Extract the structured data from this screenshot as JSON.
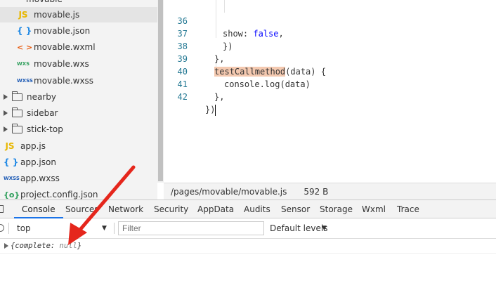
{
  "file_tree": {
    "partial_top_label": "movable",
    "items": [
      {
        "label": "movable.js",
        "icon_text": "JS",
        "kind": "js",
        "selected": true
      },
      {
        "label": "movable.json",
        "icon_text": "{ }",
        "kind": "json"
      },
      {
        "label": "movable.wxml",
        "icon_text": "< >",
        "kind": "wxml"
      },
      {
        "label": "movable.wxs",
        "icon_text": "WXS",
        "kind": "wxs"
      },
      {
        "label": "movable.wxss",
        "icon_text": "WXSS",
        "kind": "wxss"
      },
      {
        "label": "nearby",
        "kind": "folder"
      },
      {
        "label": "sidebar",
        "kind": "folder"
      },
      {
        "label": "stick-top",
        "kind": "folder"
      },
      {
        "label": "app.js",
        "icon_text": "JS",
        "kind": "js"
      },
      {
        "label": "app.json",
        "icon_text": "{ }",
        "kind": "json"
      },
      {
        "label": "app.wxss",
        "icon_text": "WXSS",
        "kind": "wxss"
      },
      {
        "label": "project.config.json",
        "icon_text": "{o}",
        "kind": "config"
      }
    ]
  },
  "editor": {
    "lines": [
      {
        "number": "36",
        "pre": "show: ",
        "keyword": "false",
        "post": ","
      },
      {
        "number": "37",
        "text": "})"
      },
      {
        "number": "38",
        "text": "},"
      },
      {
        "number": "39",
        "highlight": "testCallmethod",
        "post": "(data) {"
      },
      {
        "number": "40",
        "text": "console.log(data)"
      },
      {
        "number": "41",
        "text": "},"
      },
      {
        "number": "42",
        "text": "})"
      }
    ]
  },
  "status_bar": {
    "path": "/pages/movable/movable.js",
    "size": "592 B"
  },
  "devtools": {
    "tabs": [
      "Console",
      "Sources",
      "Network",
      "Security",
      "AppData",
      "Audits",
      "Sensor",
      "Storage",
      "Wxml",
      "Trace"
    ],
    "active_tab": "Console",
    "context": "top",
    "filter_placeholder": "Filter",
    "levels_label": "Default levels",
    "dropdown_glyph": "▼"
  },
  "console": {
    "log_open": "{complete: ",
    "log_null": "null",
    "log_close": "}"
  },
  "colors": {
    "accent": "#1a73e8",
    "annotation": "#e5261c",
    "highlight": "#f4c9b0",
    "keyword": "#0000ff"
  }
}
